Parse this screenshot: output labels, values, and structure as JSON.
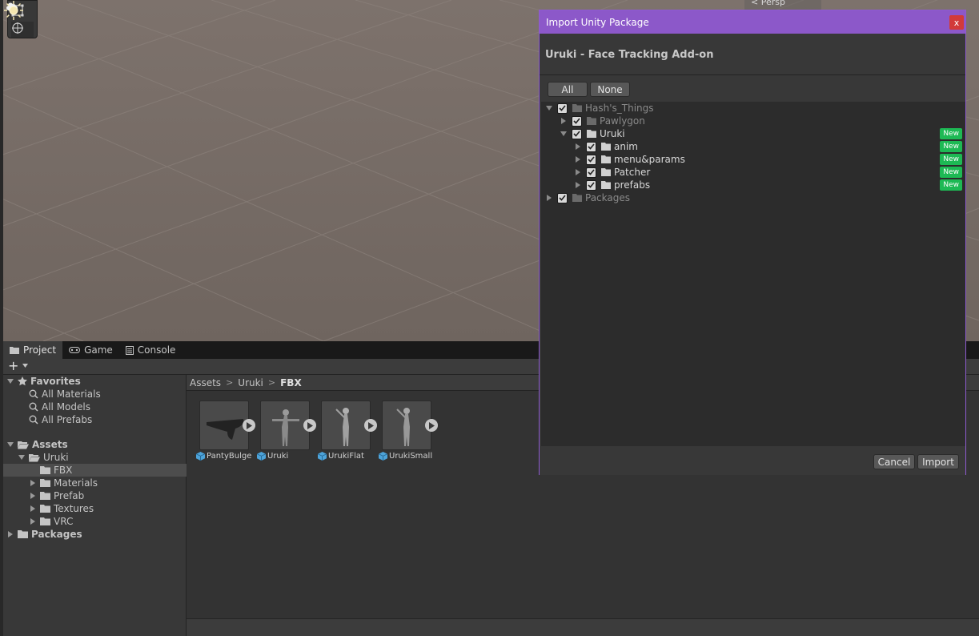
{
  "scene": {
    "projection_label": "Persp",
    "gizmos": [
      "cloud-icon",
      "sun-icon"
    ],
    "tools": [
      "rect-tool-icon",
      "transform-tool-icon"
    ]
  },
  "tabs": [
    {
      "label": "Project",
      "icon": "folder-icon"
    },
    {
      "label": "Game",
      "icon": "gamepad-icon"
    },
    {
      "label": "Console",
      "icon": "console-icon"
    }
  ],
  "project": {
    "add_label": "+",
    "tree": {
      "favorites_label": "Favorites",
      "favorites": [
        "All Materials",
        "All Models",
        "All Prefabs"
      ],
      "assets_label": "Assets",
      "uruki_label": "Uruki",
      "uruki_children": [
        "FBX",
        "Materials",
        "Prefab",
        "Textures",
        "VRC"
      ],
      "packages_label": "Packages"
    },
    "breadcrumb": [
      "Assets",
      "Uruki",
      "FBX"
    ],
    "assets": [
      {
        "name": "PantyBulge"
      },
      {
        "name": "Uruki"
      },
      {
        "name": "UrukiFlat"
      },
      {
        "name": "UrukiSmall"
      }
    ]
  },
  "dialog": {
    "title": "Import Unity Package",
    "close_label": "x",
    "package_name": "Uruki - Face Tracking Add-on",
    "all_label": "All",
    "none_label": "None",
    "cancel_label": "Cancel",
    "import_label": "Import",
    "new_label": "New",
    "items": [
      {
        "label": "Hash's_Things",
        "depth": 0,
        "expanded": true,
        "checked": true,
        "dim": true,
        "new": false
      },
      {
        "label": "Pawlygon",
        "depth": 1,
        "expanded": false,
        "checked": true,
        "dim": true,
        "new": false
      },
      {
        "label": "Uruki",
        "depth": 1,
        "expanded": true,
        "checked": true,
        "dim": false,
        "new": true
      },
      {
        "label": "anim",
        "depth": 2,
        "expanded": false,
        "checked": true,
        "dim": false,
        "new": true
      },
      {
        "label": "menu&params",
        "depth": 2,
        "expanded": false,
        "checked": true,
        "dim": false,
        "new": true
      },
      {
        "label": "Patcher",
        "depth": 2,
        "expanded": false,
        "checked": true,
        "dim": false,
        "new": true
      },
      {
        "label": "prefabs",
        "depth": 2,
        "expanded": false,
        "checked": true,
        "dim": false,
        "new": true
      },
      {
        "label": "Packages",
        "depth": 0,
        "expanded": false,
        "checked": true,
        "dim": true,
        "new": false
      }
    ]
  },
  "colors": {
    "dialog_accent": "#8c58c9",
    "new_badge": "#1db954",
    "close_button": "#d23a3a"
  }
}
